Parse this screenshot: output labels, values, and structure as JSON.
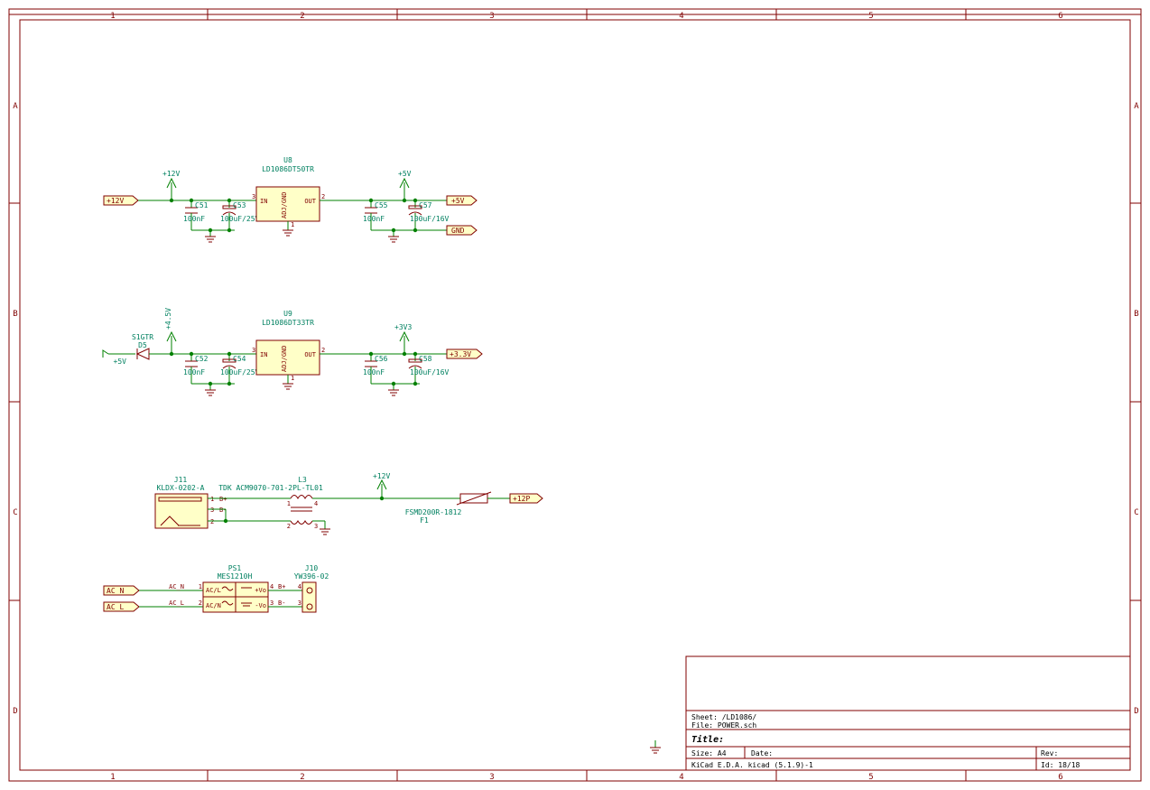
{
  "frame": {
    "cols": [
      "1",
      "2",
      "3",
      "4",
      "5",
      "6"
    ],
    "rows": [
      "A",
      "B",
      "C",
      "D"
    ]
  },
  "titleblock": {
    "sheet": "Sheet: /LD1086/",
    "file": "File: POWER.sch",
    "title": "Title:",
    "size": "Size: A4",
    "date": "Date:",
    "rev": "Rev:",
    "gen": "KiCad E.D.A.  kicad (5.1.9)-1",
    "id": "Id: 18/18"
  },
  "reg1": {
    "u": {
      "ref": "U8",
      "val": "LD1086DT50TR",
      "pins": {
        "in": "IN",
        "out": "OUT",
        "adj": "ADJ/GND",
        "p1": "1",
        "p2": "2",
        "p3": "3"
      }
    },
    "in_pwr": "+12V",
    "in_lbl": "+12V",
    "out_pwr": "+5V",
    "out_lbl": "+5V",
    "gnd_lbl": "GND",
    "c1": {
      "ref": "C51",
      "val": "100nF"
    },
    "c2": {
      "ref": "C53",
      "val": "100uF/25V"
    },
    "c3": {
      "ref": "C55",
      "val": "100nF"
    },
    "c4": {
      "ref": "C57",
      "val": "100uF/16V"
    }
  },
  "reg2": {
    "u": {
      "ref": "U9",
      "val": "LD1086DT33TR",
      "pins": {
        "in": "IN",
        "out": "OUT",
        "adj": "ADJ/GND",
        "p1": "1",
        "p2": "2",
        "p3": "3"
      }
    },
    "in_lbl": "+5V",
    "d": {
      "ref": "D5",
      "val": "S1GTR"
    },
    "in_pwr": "+4.5V",
    "out_pwr": "+3V3",
    "out_lbl": "+3.3V",
    "c1": {
      "ref": "C52",
      "val": "100nF"
    },
    "c2": {
      "ref": "C54",
      "val": "100uF/25V"
    },
    "c3": {
      "ref": "C56",
      "val": "100nF"
    },
    "c4": {
      "ref": "C58",
      "val": "100uF/16V"
    }
  },
  "dc": {
    "j": {
      "ref": "J11",
      "val": "KLDX-0202-A",
      "p1": "1",
      "p2": "2",
      "p3": "3",
      "bp": "B+",
      "bm": "B-"
    },
    "l": {
      "ref": "L3",
      "val": "TDK ACM9070-701-2PL-TL01",
      "p1": "1",
      "p2": "2",
      "p3": "3",
      "p4": "4"
    },
    "pwr": "+12V",
    "f": {
      "ref": "F1",
      "val": "FSMD200R-1812"
    },
    "lbl": "+12P"
  },
  "ac": {
    "ps": {
      "ref": "PS1",
      "val": "MES1210H",
      "acl": "AC/L",
      "acn": "AC/N",
      "vp": "+Vo",
      "vm": "-Vo",
      "p1": "1",
      "p2": "2",
      "p3": "3",
      "p4": "4"
    },
    "n": "AC_N",
    "l": "AC_L",
    "j": {
      "ref": "J10",
      "val": "YW396-02",
      "bp": "B+",
      "bm": "B-",
      "p3": "3",
      "p4": "4"
    }
  }
}
